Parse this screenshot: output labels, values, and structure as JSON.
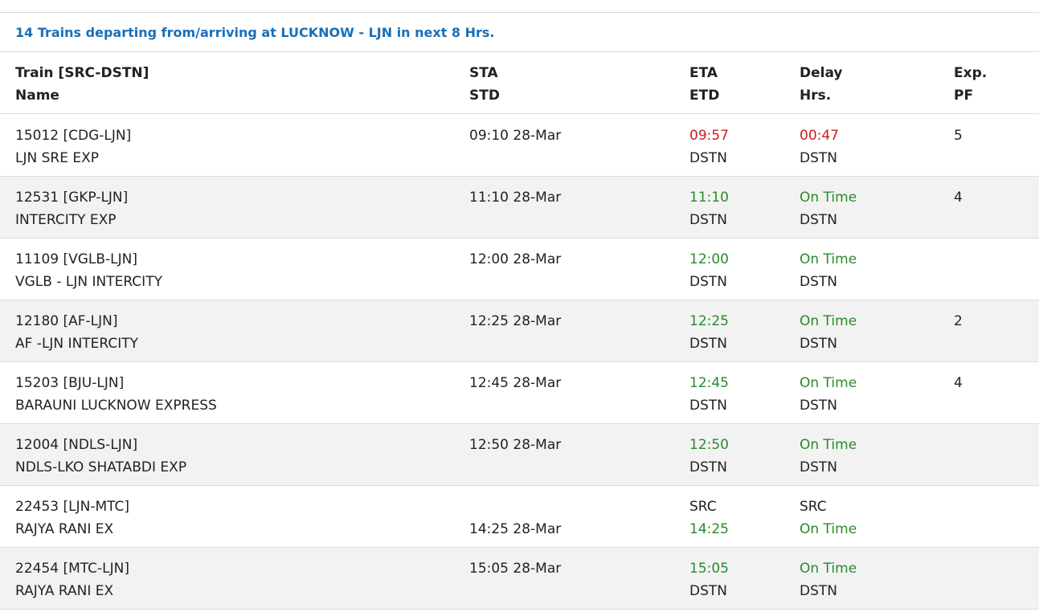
{
  "caption": "14 Trains departing from/arriving at LUCKNOW - LJN in next 8 Hrs.",
  "colors": {
    "caption": "#1a6fb8",
    "late": "#d01c1c",
    "on_time": "#2a8a2a"
  },
  "headers": [
    {
      "line1": "Train [SRC-DSTN]",
      "line2": "Name"
    },
    {
      "line1": "STA",
      "line2": "STD"
    },
    {
      "line1": "ETA",
      "line2": "ETD"
    },
    {
      "line1": "Delay",
      "line2": "Hrs."
    },
    {
      "line1": "Exp.",
      "line2": "PF"
    }
  ],
  "rows": [
    {
      "train": "15012 [CDG-LJN]",
      "name": "LJN SRE EXP",
      "sched1": "09:10 28-Mar",
      "sched2": "",
      "eta1": "09:57",
      "eta2": "DSTN",
      "delay1": "00:47",
      "delay2": "DSTN",
      "pf": "5"
    },
    {
      "train": "12531 [GKP-LJN]",
      "name": "INTERCITY EXP",
      "sched1": "11:10 28-Mar",
      "sched2": "",
      "eta1": "11:10",
      "eta2": "DSTN",
      "delay1": "On Time",
      "delay2": "DSTN",
      "pf": "4"
    },
    {
      "train": "11109 [VGLB-LJN]",
      "name": "VGLB - LJN INTERCITY",
      "sched1": "12:00 28-Mar",
      "sched2": "",
      "eta1": "12:00",
      "eta2": "DSTN",
      "delay1": "On Time",
      "delay2": "DSTN",
      "pf": ""
    },
    {
      "train": "12180 [AF-LJN]",
      "name": "AF -LJN INTERCITY",
      "sched1": "12:25 28-Mar",
      "sched2": "",
      "eta1": "12:25",
      "eta2": "DSTN",
      "delay1": "On Time",
      "delay2": "DSTN",
      "pf": "2"
    },
    {
      "train": "15203 [BJU-LJN]",
      "name": "BARAUNI LUCKNOW EXPRESS",
      "sched1": "12:45 28-Mar",
      "sched2": "",
      "eta1": "12:45",
      "eta2": "DSTN",
      "delay1": "On Time",
      "delay2": "DSTN",
      "pf": "4"
    },
    {
      "train": "12004 [NDLS-LJN]",
      "name": "NDLS-LKO SHATABDI EXP",
      "sched1": "12:50 28-Mar",
      "sched2": "",
      "eta1": "12:50",
      "eta2": "DSTN",
      "delay1": "On Time",
      "delay2": "DSTN",
      "pf": ""
    },
    {
      "train": "22453 [LJN-MTC]",
      "name": "RAJYA RANI EX",
      "sched1": "",
      "sched2": "14:25 28-Mar",
      "eta1": "SRC",
      "eta2": "14:25",
      "delay1": "SRC",
      "delay2": "On Time",
      "pf": ""
    },
    {
      "train": "22454 [MTC-LJN]",
      "name": "RAJYA RANI EX",
      "sched1": "15:05 28-Mar",
      "sched2": "",
      "eta1": "15:05",
      "eta2": "DSTN",
      "delay1": "On Time",
      "delay2": "DSTN",
      "pf": ""
    }
  ]
}
